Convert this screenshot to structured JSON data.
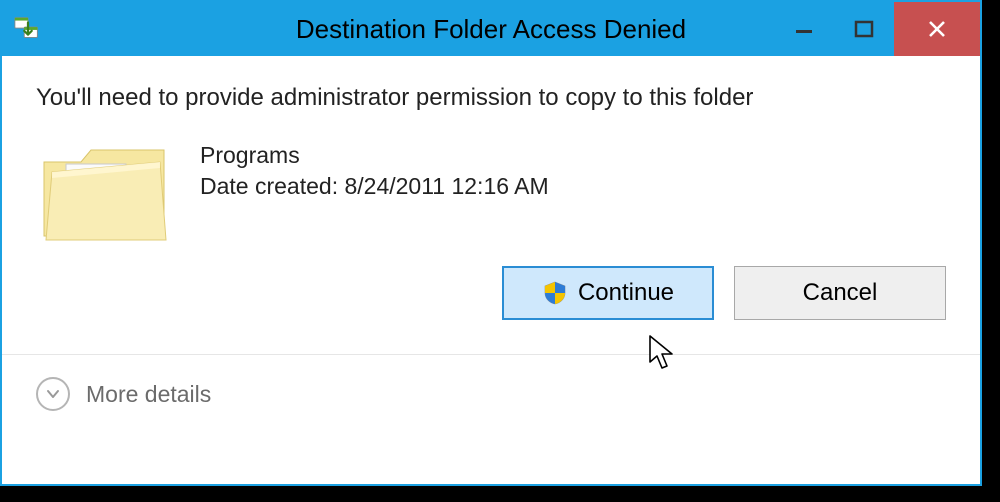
{
  "window": {
    "title": "Destination Folder Access Denied"
  },
  "dialog": {
    "message": "You'll need to provide administrator permission to copy to this folder",
    "folder": {
      "name": "Programs",
      "date_created_label": "Date created: 8/24/2011 12:16 AM"
    },
    "buttons": {
      "continue": "Continue",
      "cancel": "Cancel"
    },
    "more_details": "More details"
  }
}
